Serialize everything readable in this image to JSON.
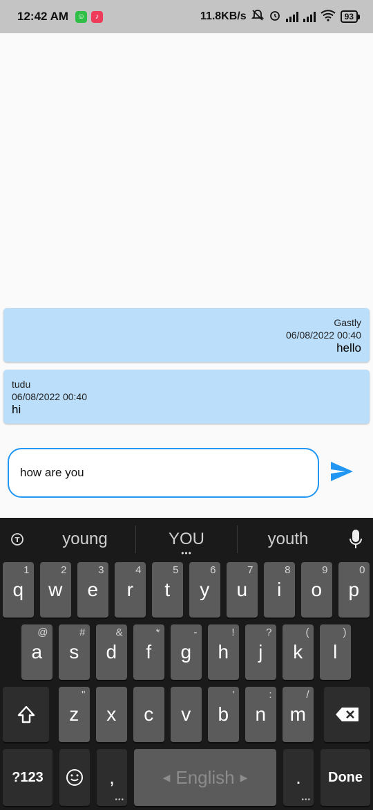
{
  "status_bar": {
    "time": "12:42 AM",
    "net_speed": "11.8KB/s",
    "battery": "93"
  },
  "messages": [
    {
      "sender": "Gastly",
      "time": "06/08/2022 00:40",
      "text": "hello",
      "align": "right"
    },
    {
      "sender": "tudu",
      "time": "06/08/2022 00:40",
      "text": "hi",
      "align": "left"
    }
  ],
  "input": {
    "value": "how are you"
  },
  "colors": {
    "bubble": "#bbdefb",
    "accent": "#2196f3"
  },
  "keyboard": {
    "suggestions": [
      "young",
      "YOU",
      "youth"
    ],
    "row1": [
      {
        "label": "q",
        "hint": "1"
      },
      {
        "label": "w",
        "hint": "2"
      },
      {
        "label": "e",
        "hint": "3"
      },
      {
        "label": "r",
        "hint": "4"
      },
      {
        "label": "t",
        "hint": "5"
      },
      {
        "label": "y",
        "hint": "6"
      },
      {
        "label": "u",
        "hint": "7"
      },
      {
        "label": "i",
        "hint": "8"
      },
      {
        "label": "o",
        "hint": "9"
      },
      {
        "label": "p",
        "hint": "0"
      }
    ],
    "row2": [
      {
        "label": "a",
        "hint": "@"
      },
      {
        "label": "s",
        "hint": "#"
      },
      {
        "label": "d",
        "hint": "&"
      },
      {
        "label": "f",
        "hint": "*"
      },
      {
        "label": "g",
        "hint": "-"
      },
      {
        "label": "h",
        "hint": "!"
      },
      {
        "label": "j",
        "hint": "?"
      },
      {
        "label": "k",
        "hint": "("
      },
      {
        "label": "l",
        "hint": ")"
      }
    ],
    "row3": [
      {
        "label": "z",
        "hint": "\""
      },
      {
        "label": "x",
        "hint": ""
      },
      {
        "label": "c",
        "hint": ""
      },
      {
        "label": "v",
        "hint": ""
      },
      {
        "label": "b",
        "hint": "'"
      },
      {
        "label": "n",
        "hint": ":"
      },
      {
        "label": "m",
        "hint": "/"
      }
    ],
    "symbols_label": "?123",
    "comma_label": ",",
    "space_label": "English",
    "period_label": ".",
    "done_label": "Done"
  }
}
